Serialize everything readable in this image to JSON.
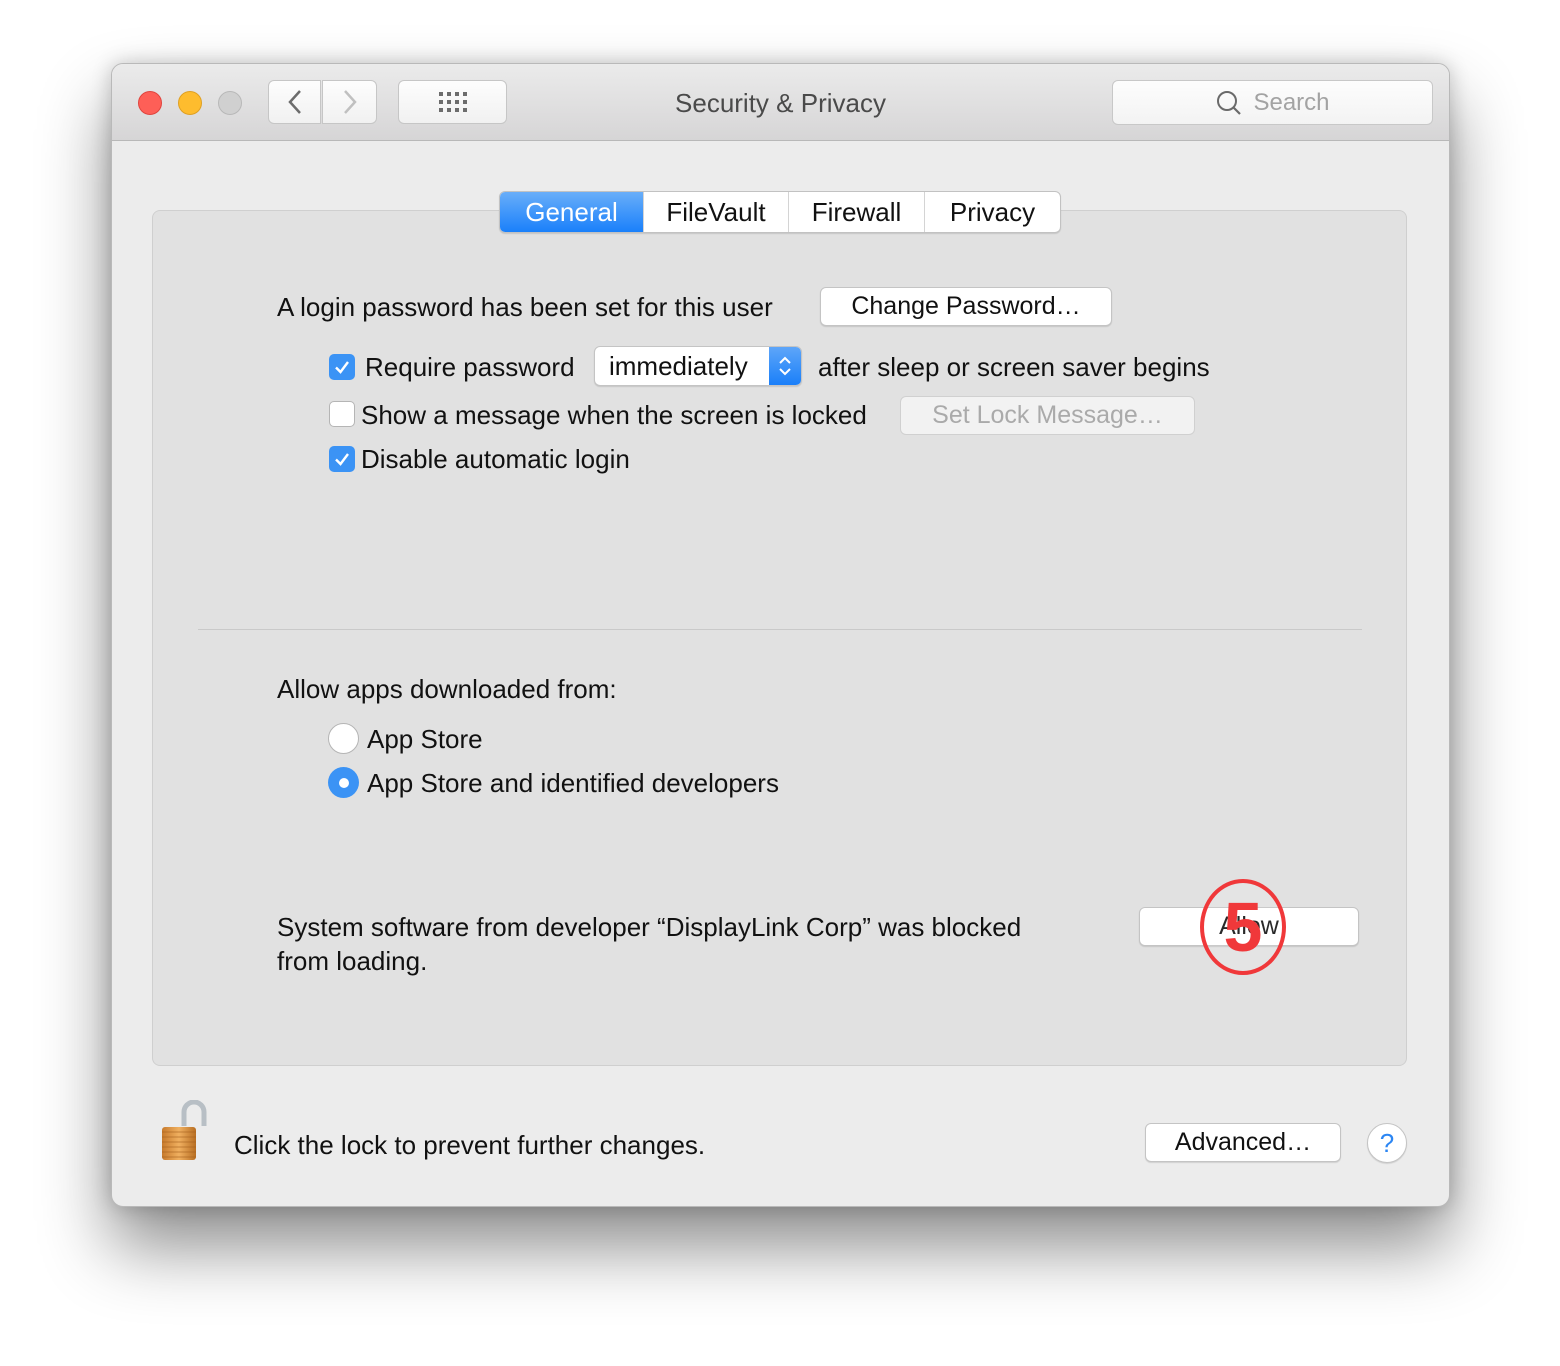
{
  "window": {
    "title": "Security & Privacy",
    "search_placeholder": "Search"
  },
  "toolbar": {
    "back_icon": "chevron-left-icon",
    "forward_icon": "chevron-right-icon",
    "show_all_icon": "grid-icon"
  },
  "tabs": [
    {
      "label": "General",
      "active": true
    },
    {
      "label": "FileVault",
      "active": false
    },
    {
      "label": "Firewall",
      "active": false
    },
    {
      "label": "Privacy",
      "active": false
    }
  ],
  "general": {
    "login_password_text": "A login password has been set for this user",
    "change_password_label": "Change Password…",
    "require_password": {
      "label": "Require password",
      "checked": true
    },
    "require_password_delay": "immediately",
    "after_sleep_text": "after sleep or screen saver begins",
    "show_message": {
      "label": "Show a message when the screen is locked",
      "checked": false
    },
    "set_lock_message_label": "Set Lock Message…",
    "disable_auto_login": {
      "label": "Disable automatic login",
      "checked": true
    }
  },
  "gatekeeper": {
    "heading": "Allow apps downloaded from:",
    "options": [
      {
        "label": "App Store",
        "selected": false
      },
      {
        "label": "App Store and identified developers",
        "selected": true
      }
    ]
  },
  "blocked": {
    "message_line1": "System software from developer “DisplayLink Corp” was blocked",
    "message_line2": "from loading.",
    "allow_label": "Allow"
  },
  "annotation": {
    "step_number": "5",
    "color": "#f0383a"
  },
  "footer": {
    "lock_text": "Click the lock to prevent further changes.",
    "advanced_label": "Advanced…",
    "help_label": "?"
  },
  "colors": {
    "accent": "#1a80fa",
    "close": "#fe5f57",
    "minimize": "#febc2e"
  }
}
